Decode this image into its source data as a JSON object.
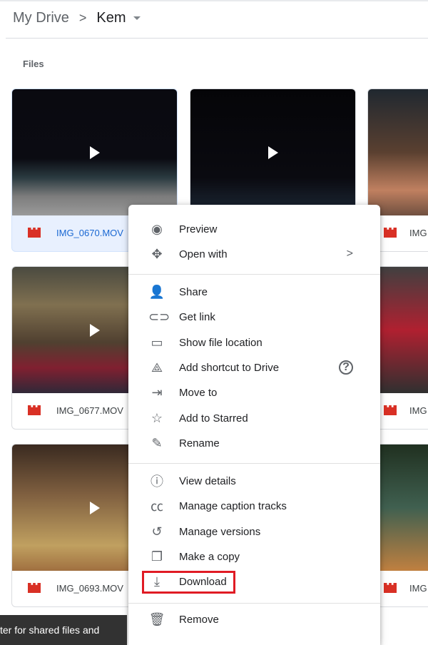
{
  "breadcrumb": {
    "root": "My Drive",
    "separator": ">",
    "current": "Kem"
  },
  "section_label": "Files",
  "files": [
    {
      "name": "IMG_0670.MOV",
      "selected": true
    },
    {
      "name": "",
      "selected": false
    },
    {
      "name": "IMG",
      "selected": false
    },
    {
      "name": "IMG_0677.MOV",
      "selected": false
    },
    {
      "name": "",
      "selected": false
    },
    {
      "name": "IMG",
      "selected": false
    },
    {
      "name": "IMG_0693.MOV",
      "selected": false
    },
    {
      "name": "",
      "selected": false
    },
    {
      "name": "IMG",
      "selected": false
    }
  ],
  "menu": {
    "items": [
      {
        "label": "Preview",
        "icon": "eye-icon"
      },
      {
        "label": "Open with",
        "icon": "move-arrows-icon",
        "submenu": ">"
      },
      {
        "label": "Share",
        "icon": "person-add-icon"
      },
      {
        "label": "Get link",
        "icon": "link-icon"
      },
      {
        "label": "Show file location",
        "icon": "folder-icon"
      },
      {
        "label": "Add shortcut to Drive",
        "icon": "add-shortcut-icon",
        "help": "?"
      },
      {
        "label": "Move to",
        "icon": "move-to-folder-icon"
      },
      {
        "label": "Add to Starred",
        "icon": "star-icon"
      },
      {
        "label": "Rename",
        "icon": "pencil-icon"
      },
      {
        "label": "View details",
        "icon": "info-icon"
      },
      {
        "label": "Manage caption tracks",
        "icon": "closed-caption-icon"
      },
      {
        "label": "Manage versions",
        "icon": "history-icon"
      },
      {
        "label": "Make a copy",
        "icon": "copy-icon"
      },
      {
        "label": "Download",
        "icon": "download-icon"
      },
      {
        "label": "Remove",
        "icon": "trash-icon"
      }
    ]
  },
  "toast": {
    "text": "ter for shared files and"
  },
  "colors": {
    "highlight": "#e01b24",
    "video_icon": "#d93025",
    "selected_bg": "#e8f0fe"
  }
}
